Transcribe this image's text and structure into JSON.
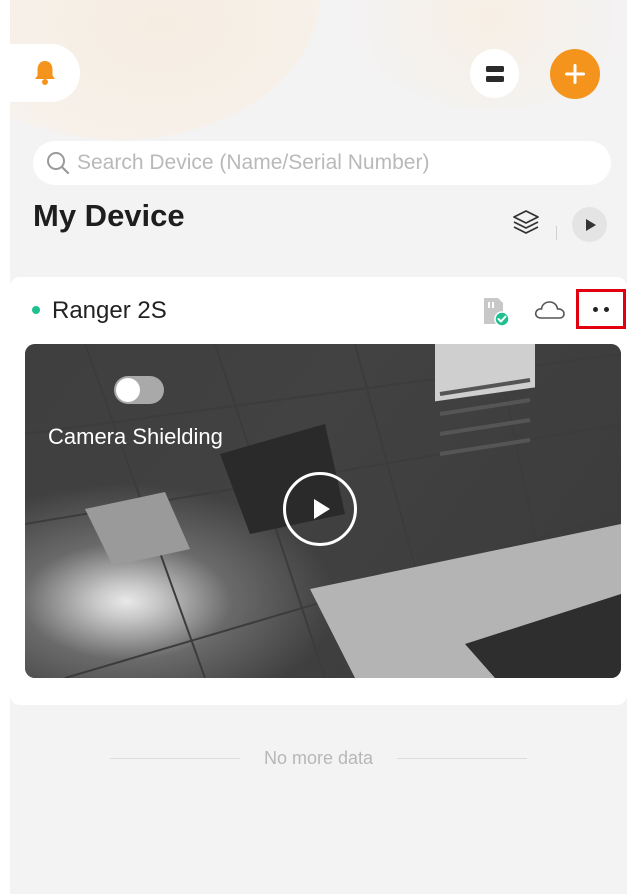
{
  "header": {
    "bell_icon": "bell-icon",
    "menu_icon": "list-icon",
    "add_icon": "plus-icon",
    "accent_color": "#f5941d"
  },
  "search": {
    "placeholder": "Search Device (Name/Serial Number)",
    "value": ""
  },
  "section": {
    "title": "My Device"
  },
  "device": {
    "name": "Ranger 2S",
    "status_color": "#1fbf8f",
    "camera_shielding_label": "Camera Shielding",
    "camera_shielding_on": false
  },
  "footer": {
    "no_more_text": "No more data"
  }
}
